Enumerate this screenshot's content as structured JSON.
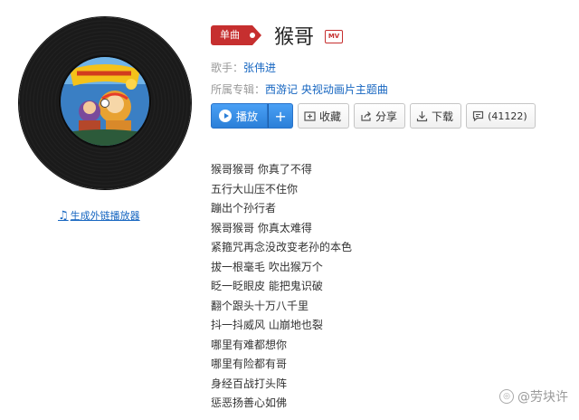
{
  "song": {
    "badge": "单曲",
    "title": "猴哥",
    "mv_badge": "MV",
    "artist_label": "歌手：",
    "artist": "张伟进",
    "album_label": "所属专辑：",
    "album": "西游记 央视动画片主题曲"
  },
  "actions": {
    "play": "播放",
    "add": "+",
    "collect": "收藏",
    "share": "分享",
    "download": "下载",
    "comments": "(41122)"
  },
  "ext_link": "生成外链播放器",
  "lyrics": [
    "猴哥猴哥 你真了不得",
    "五行大山压不住你",
    "蹦出个孙行者",
    "猴哥猴哥 你真太难得",
    "紧箍咒再念没改变老孙的本色",
    "拔一根毫毛 吹出猴万个",
    "眨一眨眼皮 能把鬼识破",
    "翻个跟头十万八千里",
    "抖一抖威风 山崩地也裂",
    "哪里有难都想你",
    "哪里有险都有哥",
    "身经百战打头阵",
    "惩恶扬善心如佛"
  ],
  "watermark": "@劳块许",
  "colors": {
    "accent_red": "#c62f2f",
    "link_blue": "#1565c0",
    "play_blue": "#2b7fd8"
  },
  "icons": [
    "music-note-icon",
    "play-icon",
    "add-icon",
    "collect-icon",
    "share-icon",
    "download-icon",
    "comment-icon",
    "mv-icon"
  ]
}
